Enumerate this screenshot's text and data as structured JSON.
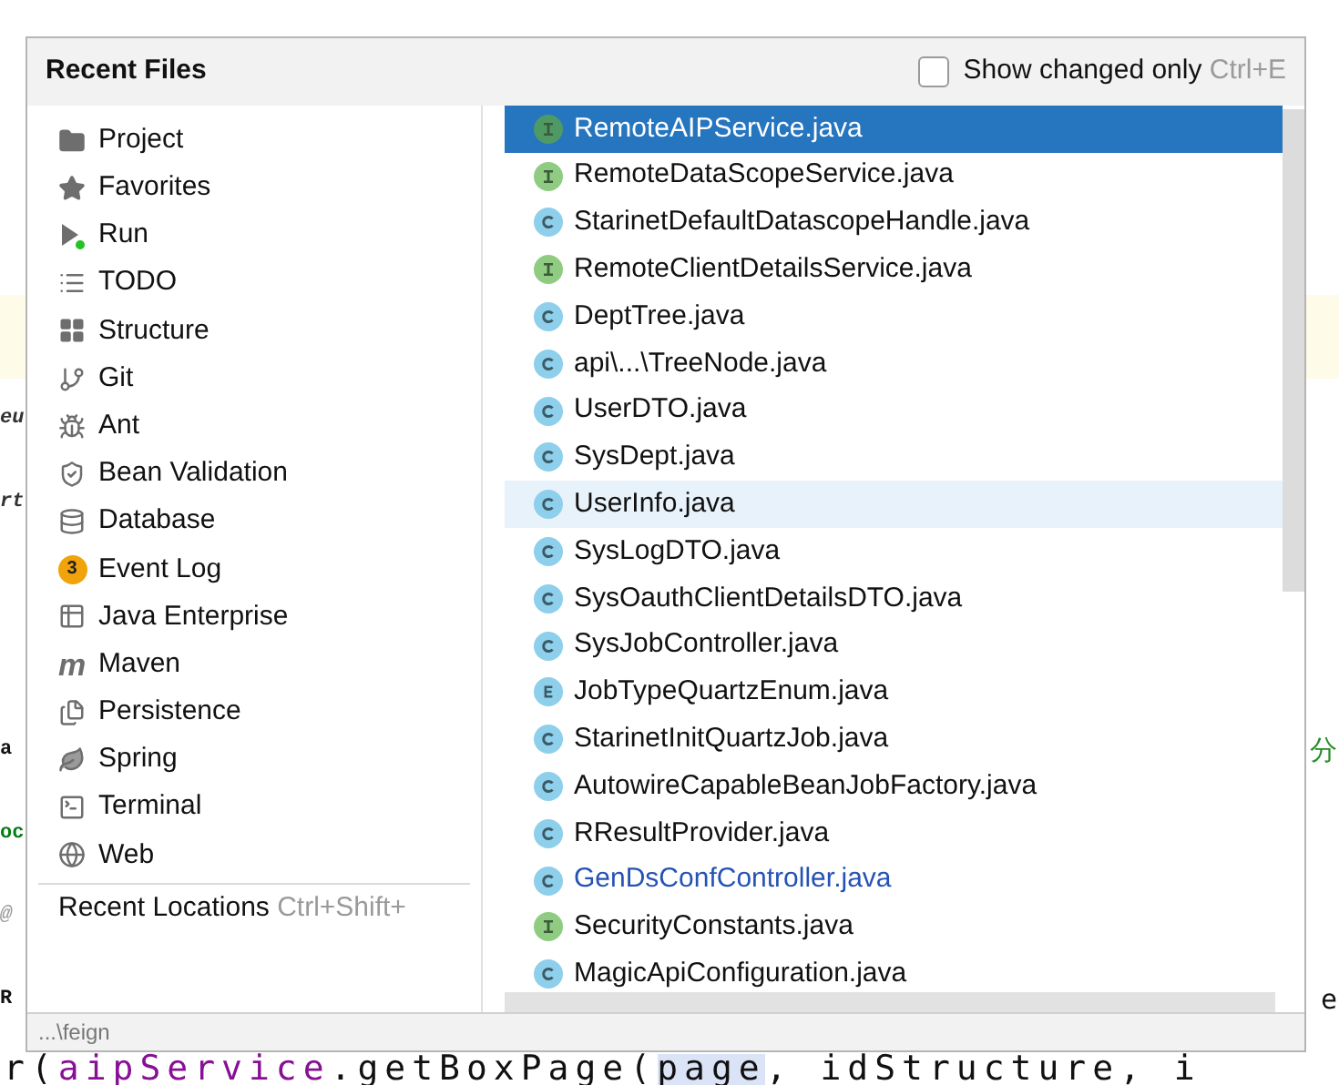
{
  "editor": {
    "lines": [
      {
        "highlighted": false
      },
      {
        "highlighted": false
      },
      {
        "highlighted": false
      },
      {
        "highlighted": false
      },
      {
        "highlighted": true
      },
      {
        "highlighted": false,
        "left": {
          "text": "eu",
          "kind": "italic"
        }
      },
      {
        "highlighted": false,
        "left": {
          "text": "rt",
          "kind": "italic"
        }
      },
      {
        "highlighted": false
      },
      {
        "highlighted": false
      },
      {
        "highlighted": false,
        "left": {
          "text": "a",
          "kind": "plain"
        },
        "right": {
          "text": "分",
          "kind": "comment"
        }
      },
      {
        "highlighted": false,
        "left": {
          "text": "oc",
          "kind": "string"
        }
      },
      {
        "highlighted": false,
        "left": {
          "text": "@",
          "kind": "annotation"
        }
      },
      {
        "highlighted": false,
        "left": {
          "text": "R",
          "kind": "plain"
        },
        "right": {
          "text": "e",
          "kind": "plain"
        }
      },
      {
        "highlighted": false,
        "segments": [
          {
            "text": "r(",
            "kind": "plain"
          },
          {
            "text": "aipService",
            "kind": "field"
          },
          {
            "text": ".getBoxPage(",
            "kind": "plain"
          },
          {
            "text": "page",
            "kind": "match"
          },
          {
            "text": ", idStructure, i",
            "kind": "plain"
          }
        ]
      }
    ]
  },
  "popup": {
    "title": "Recent Files",
    "show_changed_only": {
      "label": "Show changed only",
      "shortcut": "Ctrl+E",
      "checked": false
    },
    "tool_windows": [
      {
        "label": "Project"
      },
      {
        "label": "Favorites"
      },
      {
        "label": "Run"
      },
      {
        "label": "TODO"
      },
      {
        "label": "Structure"
      },
      {
        "label": "Git"
      },
      {
        "label": "Ant"
      },
      {
        "label": "Bean Validation"
      },
      {
        "label": "Database"
      },
      {
        "label": "Event Log",
        "badge": "3"
      },
      {
        "label": "Java Enterprise"
      },
      {
        "label": "Maven",
        "glyph": "m"
      },
      {
        "label": "Persistence"
      },
      {
        "label": "Spring"
      },
      {
        "label": "Terminal"
      },
      {
        "label": "Web"
      }
    ],
    "recent_locations": {
      "label": "Recent Locations",
      "shortcut": "Ctrl+Shift+"
    },
    "files": [
      {
        "name": "RemoteAIPService.java",
        "kind": "interface",
        "selected": true,
        "hovered": false,
        "modified": false
      },
      {
        "name": "RemoteDataScopeService.java",
        "kind": "interface",
        "selected": false,
        "hovered": false,
        "modified": false
      },
      {
        "name": "StarinetDefaultDatascopeHandle.java",
        "kind": "class",
        "selected": false,
        "hovered": false,
        "modified": false
      },
      {
        "name": "RemoteClientDetailsService.java",
        "kind": "interface",
        "selected": false,
        "hovered": false,
        "modified": false
      },
      {
        "name": "DeptTree.java",
        "kind": "class",
        "selected": false,
        "hovered": false,
        "modified": false
      },
      {
        "name": "api\\...\\TreeNode.java",
        "kind": "class",
        "selected": false,
        "hovered": false,
        "modified": false
      },
      {
        "name": "UserDTO.java",
        "kind": "class",
        "selected": false,
        "hovered": false,
        "modified": false
      },
      {
        "name": "SysDept.java",
        "kind": "class",
        "selected": false,
        "hovered": false,
        "modified": false
      },
      {
        "name": "UserInfo.java",
        "kind": "class",
        "selected": false,
        "hovered": true,
        "modified": false
      },
      {
        "name": "SysLogDTO.java",
        "kind": "class",
        "selected": false,
        "hovered": false,
        "modified": false
      },
      {
        "name": "SysOauthClientDetailsDTO.java",
        "kind": "class",
        "selected": false,
        "hovered": false,
        "modified": false
      },
      {
        "name": "SysJobController.java",
        "kind": "class",
        "selected": false,
        "hovered": false,
        "modified": false
      },
      {
        "name": "JobTypeQuartzEnum.java",
        "kind": "enum",
        "selected": false,
        "hovered": false,
        "modified": false
      },
      {
        "name": "StarinetInitQuartzJob.java",
        "kind": "class",
        "selected": false,
        "hovered": false,
        "modified": false
      },
      {
        "name": "AutowireCapableBeanJobFactory.java",
        "kind": "class",
        "selected": false,
        "hovered": false,
        "modified": false
      },
      {
        "name": "RResultProvider.java",
        "kind": "class",
        "selected": false,
        "hovered": false,
        "modified": false
      },
      {
        "name": "GenDsConfController.java",
        "kind": "class",
        "selected": false,
        "hovered": false,
        "modified": true
      },
      {
        "name": "SecurityConstants.java",
        "kind": "interface",
        "selected": false,
        "hovered": false,
        "modified": false
      },
      {
        "name": "MagicApiConfiguration.java",
        "kind": "class",
        "selected": false,
        "hovered": false,
        "modified": false
      }
    ],
    "status": "...\\feign"
  }
}
